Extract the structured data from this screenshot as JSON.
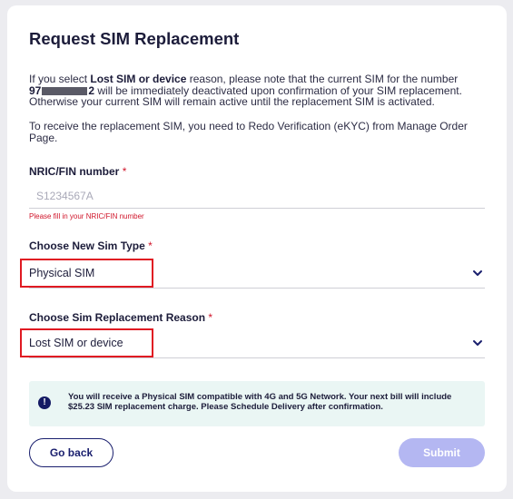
{
  "form": {
    "title": "Request SIM Replacement",
    "intro": {
      "p1_prefix": "If you select ",
      "p1_bold": "Lost SIM or device",
      "p1_mid": " reason, please note that the current SIM for the number",
      "number_start": "97",
      "number_end": "2",
      "p1_suffix": " will be immediately deactivated upon confirmation of your SIM replacement. Otherwise your current SIM will remain active until the replacement SIM is activated.",
      "p2": "To receive the replacement SIM, you need to Redo Verification (eKYC) from Manage Order Page."
    },
    "nric": {
      "label": "NRIC/FIN number",
      "required_mark": "*",
      "placeholder": "S1234567A",
      "value": "",
      "error": "Please fill in your NRIC/FIN number"
    },
    "sim_type": {
      "label": "Choose New Sim Type",
      "required_mark": "*",
      "selected": "Physical SIM"
    },
    "reason": {
      "label": "Choose Sim Replacement Reason",
      "required_mark": "*",
      "selected": "Lost SIM or device"
    },
    "info": {
      "icon": "!",
      "text": "You will receive a Physical SIM compatible with 4G and 5G Network. Your next bill will include $25.23 SIM replacement charge. Please Schedule Delivery after confirmation."
    },
    "buttons": {
      "back": "Go back",
      "submit": "Submit"
    }
  },
  "colors": {
    "primary": "#1a1f6e",
    "error": "#d0152a",
    "highlight_border": "#e01a22",
    "submit_disabled": "#b4b7f2",
    "info_bg": "#eaf6f4",
    "page_bg": "#ececf0"
  }
}
